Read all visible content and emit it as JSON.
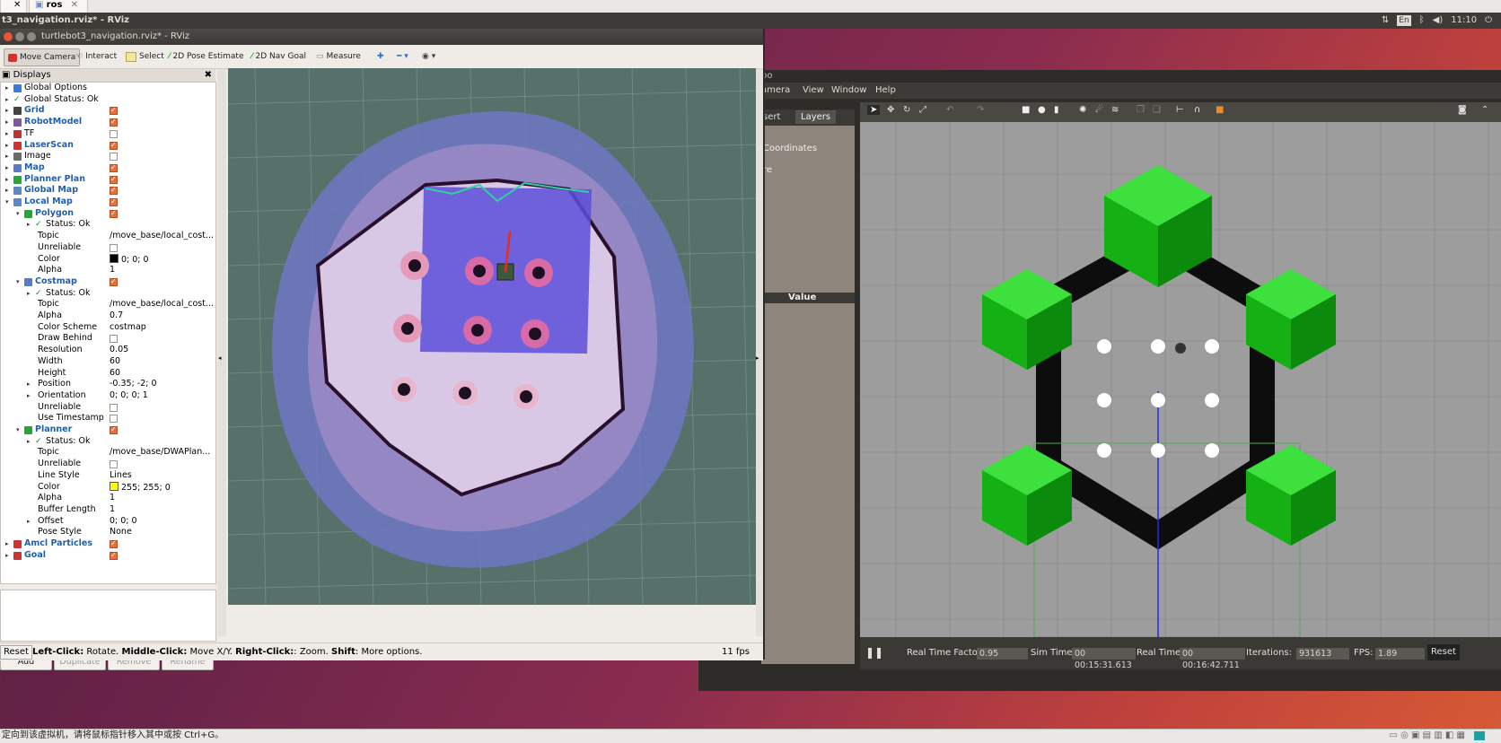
{
  "host": {
    "tabs": [
      {
        "label": "t3_navigation.rviz* - RViz"
      },
      {
        "label": "ros"
      }
    ],
    "hint": "定向到该虚拟机，请将鼠标指针移入其中或按 Ctrl+G。"
  },
  "panel": {
    "window_title": "turtlebot3_navigation.rviz* - RViz",
    "lang": "En",
    "time": "11:10"
  },
  "rviz": {
    "title": "turtlebot3_navigation.rviz* - RViz",
    "tools": [
      "Move Camera",
      "Interact",
      "Select",
      "2D Pose Estimate",
      "2D Nav Goal",
      "Measure"
    ],
    "displays_title": "Displays",
    "tree": [
      {
        "label": "Global Options",
        "indent": 0,
        "arrow": "▸",
        "icon": "globe-icon"
      },
      {
        "label": "Global Status: Ok",
        "indent": 0,
        "arrow": "▸",
        "icon": "check-icon"
      },
      {
        "label": "Grid",
        "indent": 0,
        "arrow": "▸",
        "icon": "grid-icon",
        "blue": true,
        "check": true
      },
      {
        "label": "RobotModel",
        "indent": 0,
        "arrow": "▸",
        "icon": "robot-icon",
        "blue": true,
        "check": true
      },
      {
        "label": "TF",
        "indent": 0,
        "arrow": "▸",
        "icon": "tf-icon",
        "check": false
      },
      {
        "label": "LaserScan",
        "indent": 0,
        "arrow": "▸",
        "icon": "laser-icon",
        "blue": true,
        "check": true
      },
      {
        "label": "Image",
        "indent": 0,
        "arrow": "▸",
        "icon": "image-icon",
        "check": false
      },
      {
        "label": "Map",
        "indent": 0,
        "arrow": "▸",
        "icon": "map-icon",
        "blue": true,
        "check": true
      },
      {
        "label": "Planner Plan",
        "indent": 0,
        "arrow": "▸",
        "icon": "path-icon",
        "blue": true,
        "check": true
      },
      {
        "label": "Global Map",
        "indent": 0,
        "arrow": "▸",
        "icon": "folder-icon",
        "blue": true,
        "check": true
      },
      {
        "label": "Local Map",
        "indent": 0,
        "arrow": "▾",
        "icon": "folder-icon",
        "blue": true,
        "check": true
      },
      {
        "label": "Polygon",
        "indent": 1,
        "arrow": "▾",
        "icon": "polygon-icon",
        "blue": true,
        "check": true
      },
      {
        "label": "Status: Ok",
        "indent": 2,
        "arrow": "▸",
        "icon": "check-icon"
      },
      {
        "label": "Topic",
        "indent": 2,
        "value": "/move_base/local_cost..."
      },
      {
        "label": "Unreliable",
        "indent": 2,
        "check": false
      },
      {
        "label": "Color",
        "indent": 2,
        "value": "0; 0; 0",
        "swatch": "#000000"
      },
      {
        "label": "Alpha",
        "indent": 2,
        "value": "1"
      },
      {
        "label": "Costmap",
        "indent": 1,
        "arrow": "▾",
        "icon": "map-icon",
        "blue": true,
        "check": true
      },
      {
        "label": "Status: Ok",
        "indent": 2,
        "arrow": "▸",
        "icon": "check-icon"
      },
      {
        "label": "Topic",
        "indent": 2,
        "value": "/move_base/local_cost..."
      },
      {
        "label": "Alpha",
        "indent": 2,
        "value": "0.7"
      },
      {
        "label": "Color Scheme",
        "indent": 2,
        "value": "costmap"
      },
      {
        "label": "Draw Behind",
        "indent": 2,
        "check": false
      },
      {
        "label": "Resolution",
        "indent": 2,
        "value": "0.05"
      },
      {
        "label": "Width",
        "indent": 2,
        "value": "60"
      },
      {
        "label": "Height",
        "indent": 2,
        "value": "60"
      },
      {
        "label": "Position",
        "indent": 2,
        "arrow": "▸",
        "value": "-0.35; -2; 0"
      },
      {
        "label": "Orientation",
        "indent": 2,
        "arrow": "▸",
        "value": "0; 0; 0; 1"
      },
      {
        "label": "Unreliable",
        "indent": 2,
        "check": false
      },
      {
        "label": "Use Timestamp",
        "indent": 2,
        "check": false
      },
      {
        "label": "Planner",
        "indent": 1,
        "arrow": "▾",
        "icon": "path-icon",
        "blue": true,
        "check": true
      },
      {
        "label": "Status: Ok",
        "indent": 2,
        "arrow": "▸",
        "icon": "check-icon"
      },
      {
        "label": "Topic",
        "indent": 2,
        "value": "/move_base/DWAPlan..."
      },
      {
        "label": "Unreliable",
        "indent": 2,
        "check": false
      },
      {
        "label": "Line Style",
        "indent": 2,
        "value": "Lines"
      },
      {
        "label": "Color",
        "indent": 2,
        "value": "255; 255; 0",
        "swatch": "#ffff00"
      },
      {
        "label": "Alpha",
        "indent": 2,
        "value": "1"
      },
      {
        "label": "Buffer Length",
        "indent": 2,
        "value": "1"
      },
      {
        "label": "Offset",
        "indent": 2,
        "arrow": "▸",
        "value": "0; 0; 0"
      },
      {
        "label": "Pose Style",
        "indent": 2,
        "value": "None"
      },
      {
        "label": "Amcl Particles",
        "indent": 0,
        "arrow": "▸",
        "icon": "particles-icon",
        "blue": true,
        "check": true
      },
      {
        "label": "Goal",
        "indent": 0,
        "arrow": "▸",
        "icon": "goal-icon",
        "blue": true,
        "check": true
      }
    ],
    "buttons": {
      "add": "Add",
      "duplicate": "Duplicate",
      "remove": "Remove",
      "rename": "Rename"
    },
    "status": {
      "reset": "Reset",
      "b1": "Left-Click:",
      "t1": " Rotate. ",
      "b2": "Middle-Click:",
      "t2": " Move X/Y. ",
      "b3": "Right-Click:",
      "t3": ": Zoom. ",
      "b4": "Shift",
      "t4": ": More options.",
      "fps": "11 fps"
    }
  },
  "gazebo": {
    "title": "bo",
    "menu": [
      "amera",
      "View",
      "Window",
      "Help"
    ],
    "tabs": [
      "sert",
      "Layers"
    ],
    "left_items": [
      "Coordinates",
      "re"
    ],
    "value_header": "Value",
    "stats": {
      "rtf_label": "Real Time Factor:",
      "rtf": "0.95",
      "sim_label": "Sim Time:",
      "sim": "00 00:15:31.613",
      "real_label": "Real Time:",
      "real": "00 00:16:42.711",
      "iter_label": "Iterations:",
      "iter": "931613",
      "fps_label": "FPS:",
      "fps": "1.89",
      "reset": "Reset"
    }
  }
}
